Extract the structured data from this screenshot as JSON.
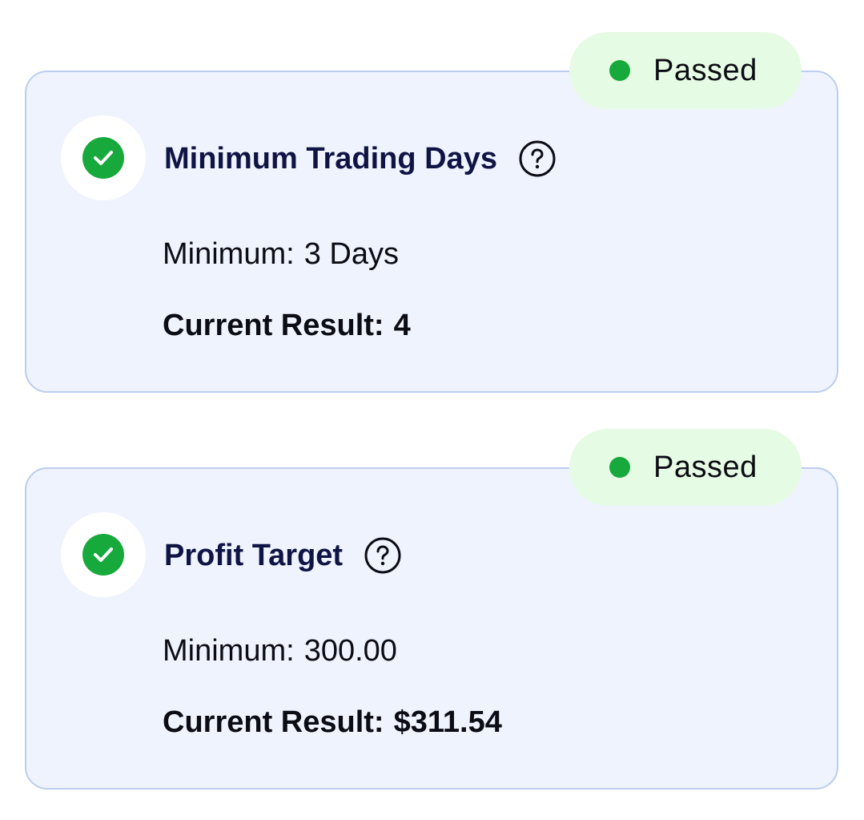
{
  "colors": {
    "card_background": "#eef3fd",
    "card_border": "#bccdef",
    "status_pill_background": "#e6fbe3",
    "status_dot": "#17a93c",
    "check_icon": "#17a93c",
    "title_text": "#0f1445",
    "body_text": "#0c0c14"
  },
  "cards": [
    {
      "status": "Passed",
      "status_icon": "green-dot",
      "check_icon": "check-circle-icon",
      "title": "Minimum Trading Days",
      "help_icon": "question-circle-icon",
      "minimum_label": "Minimum:",
      "minimum_value": "3 Days",
      "current_label": "Current Result:",
      "current_value": "4"
    },
    {
      "status": "Passed",
      "status_icon": "green-dot",
      "check_icon": "check-circle-icon",
      "title": "Profit Target",
      "help_icon": "question-circle-icon",
      "minimum_label": "Minimum:",
      "minimum_value": "300.00",
      "current_label": "Current Result:",
      "current_value": "$311.54"
    }
  ]
}
